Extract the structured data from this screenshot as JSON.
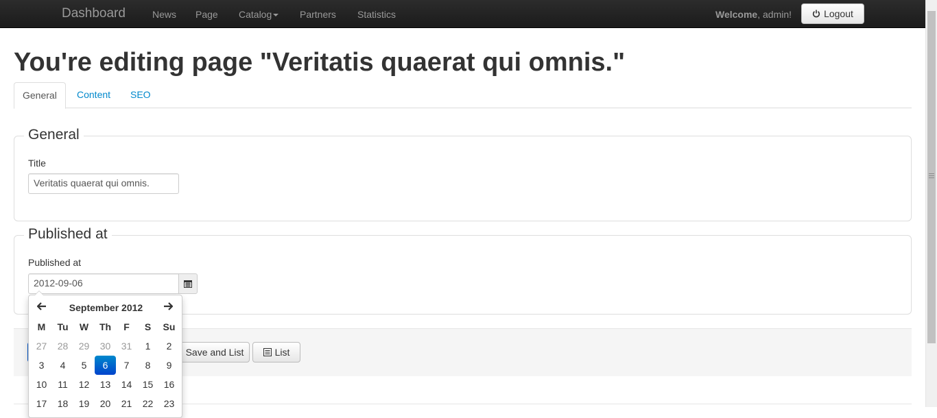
{
  "navbar": {
    "brand": "Dashboard",
    "items": [
      {
        "label": "News"
      },
      {
        "label": "Page"
      },
      {
        "label": "Catalog"
      },
      {
        "label": "Partners"
      },
      {
        "label": "Statistics"
      }
    ],
    "welcome_bold": "Welcome",
    "welcome_rest": ", admin!",
    "logout_label": "Logout"
  },
  "page": {
    "title": "You're editing page \"Veritatis quaerat qui omnis.\""
  },
  "tabs": [
    {
      "label": "General",
      "active": true
    },
    {
      "label": "Content",
      "active": false
    },
    {
      "label": "SEO",
      "active": false
    }
  ],
  "general_section": {
    "legend": "General",
    "title_label": "Title",
    "title_value": "Veritatis quaerat qui omnis."
  },
  "published_section": {
    "legend": "Published at",
    "field_label": "Published at",
    "field_value": "2012-09-06"
  },
  "actions": {
    "save_and_list": "Save and List",
    "list": "List"
  },
  "datepicker": {
    "month_title": "September 2012",
    "weekdays": [
      "M",
      "Tu",
      "W",
      "Th",
      "F",
      "S",
      "Su"
    ],
    "weeks": [
      [
        {
          "d": "27",
          "old": true
        },
        {
          "d": "28",
          "old": true
        },
        {
          "d": "29",
          "old": true
        },
        {
          "d": "30",
          "old": true
        },
        {
          "d": "31",
          "old": true
        },
        {
          "d": "1"
        },
        {
          "d": "2"
        }
      ],
      [
        {
          "d": "3"
        },
        {
          "d": "4"
        },
        {
          "d": "5"
        },
        {
          "d": "6",
          "active": true
        },
        {
          "d": "7"
        },
        {
          "d": "8"
        },
        {
          "d": "9"
        }
      ],
      [
        {
          "d": "10"
        },
        {
          "d": "11"
        },
        {
          "d": "12"
        },
        {
          "d": "13"
        },
        {
          "d": "14"
        },
        {
          "d": "15"
        },
        {
          "d": "16"
        }
      ],
      [
        {
          "d": "17"
        },
        {
          "d": "18"
        },
        {
          "d": "19"
        },
        {
          "d": "20"
        },
        {
          "d": "21"
        },
        {
          "d": "22"
        },
        {
          "d": "23"
        }
      ]
    ],
    "active_color": "#0068cc"
  }
}
